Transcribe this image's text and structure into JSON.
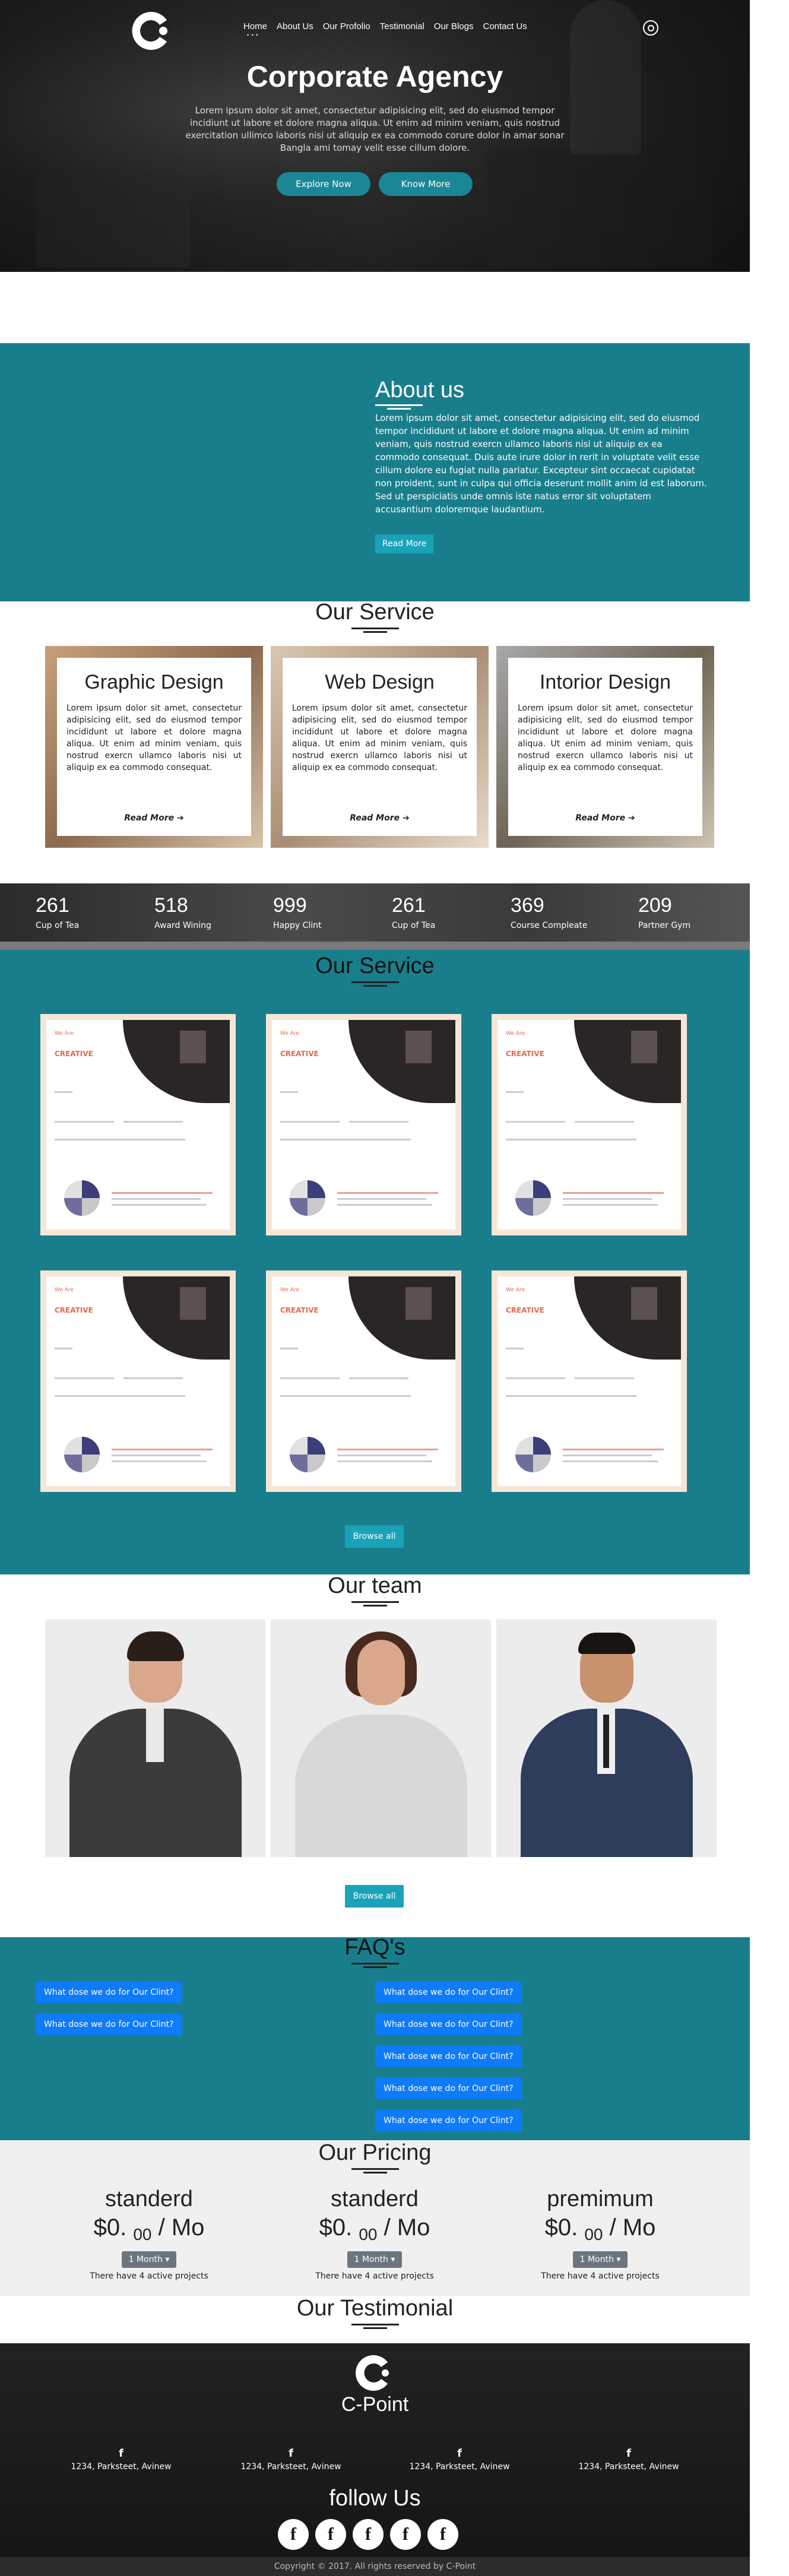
{
  "brand": {
    "accent": "#197e8c",
    "button_teal": "#1a8797",
    "faq_blue": "#0e7bfa"
  },
  "nav": {
    "items": [
      "Home",
      "About Us",
      "Our Profolio",
      "Testimonial",
      "Our Blogs",
      "Contact Us"
    ],
    "active": "Home"
  },
  "hero": {
    "title": "Corporate Agency",
    "text": "Lorem ipsum dolor sit amet, consectetur adipisicing elit, sed do eiusmod tempor incidiunt ut labore et dolore magna aliqua. Ut enim ad minim veniam, quis nostrud exercitation ullimco laboris nisi ut aliquip ex ea commodo corure dolor in amar sonar Bangla ami tomay velit esse cillum dolore.",
    "btn_primary": "Explore Now",
    "btn_secondary": "Know More"
  },
  "about": {
    "title": "About us",
    "text": "Lorem ipsum dolor sit amet, consectetur adipisicing elit, sed do eiusmod tempor incididunt ut labore et dolore magna aliqua. Ut enim ad minim veniam, quis nostrud exercn ullamco laboris nisi ut aliquip ex ea commodo consequat. Duis aute irure dolor in rerit in voluptate velit esse cillum dolore eu fugiat nulla pariatur. Excepteur sint occaecat cupidatat non proident, sunt in culpa qui officia deserunt mollit anim id est laborum. Sed ut perspiciatis unde omnis iste natus error sit voluptatem accusantium doloremque laudantium.",
    "button": "Read More"
  },
  "services": {
    "title": "Our Service",
    "cards": [
      {
        "title": "Graphic Design",
        "text": "Lorem ipsum dolor sit amet, consectetur adipisicing elit, sed do eiusmod tempor incididunt ut labore et dolore magna aliqua. Ut enim ad minim veniam, quis nostrud exercn ullamco laboris nisi ut aliquip ex ea commodo consequat.",
        "more": "Read More"
      },
      {
        "title": "Web Design",
        "text": "Lorem ipsum dolor sit amet, consectetur adipisicing elit, sed do eiusmod tempor incididunt ut labore et dolore magna aliqua. Ut enim ad minim veniam, quis nostrud exercn ullamco laboris nisi ut aliquip ex ea commodo consequat.",
        "more": "Read More"
      },
      {
        "title": "Intorior Design",
        "text": "Lorem ipsum dolor sit amet, consectetur adipisicing elit, sed do eiusmod tempor incididunt ut labore et dolore magna aliqua. Ut enim ad minim veniam, quis nostrud exercn ullamco laboris nisi ut aliquip ex ea commodo consequat.",
        "more": "Read More"
      }
    ]
  },
  "stats": [
    {
      "n": "261",
      "l": "Cup of Tea"
    },
    {
      "n": "518",
      "l": "Award Wining"
    },
    {
      "n": "999",
      "l": "Happy Clint"
    },
    {
      "n": "261",
      "l": "Cup of Tea"
    },
    {
      "n": "369",
      "l": "Course Compleate"
    },
    {
      "n": "209",
      "l": "Partner Gym"
    }
  ],
  "portfolio": {
    "title": "Our Service",
    "browse": "Browse all",
    "thumb_small": "We Are",
    "thumb_big": "CREATIVE"
  },
  "team": {
    "title": "Our team",
    "browse": "Browse all"
  },
  "faq": {
    "title": "FAQ's",
    "left": [
      "What dose we do for Our Clint?",
      "What dose we do for Our Clint?"
    ],
    "right": [
      "What dose we do for Our Clint?",
      "What dose we do for Our Clint?",
      "What dose we do for Our Clint?",
      "What dose we do for Our Clint?",
      "What dose we do for Our Clint?"
    ]
  },
  "pricing": {
    "title": "Our Pricing",
    "plans": [
      {
        "name": "standerd",
        "price": "$0.",
        "cents": "00",
        "per": " / Mo",
        "select": "1 Month",
        "desc": "There have 4 active projects"
      },
      {
        "name": "standerd",
        "price": "$0.",
        "cents": "00",
        "per": " / Mo",
        "select": "1 Month",
        "desc": "There have 4 active projects"
      },
      {
        "name": "premimum",
        "price": "$0.",
        "cents": "00",
        "per": " / Mo",
        "select": "1 Month",
        "desc": "There have 4 active projects"
      }
    ]
  },
  "testimonial": {
    "title": "Our Testimonial"
  },
  "footer": {
    "brand": "C-Point",
    "address": [
      "1234, Parksteet, Avinew",
      "1234, Parksteet, Avinew",
      "1234, Parksteet, Avinew",
      "1234, Parksteet, Avinew"
    ],
    "address_icon": "f",
    "follow": "follow Us",
    "social_icon": "f",
    "copyright": "Copyright © 2017. All rights reserved by C-Point"
  }
}
